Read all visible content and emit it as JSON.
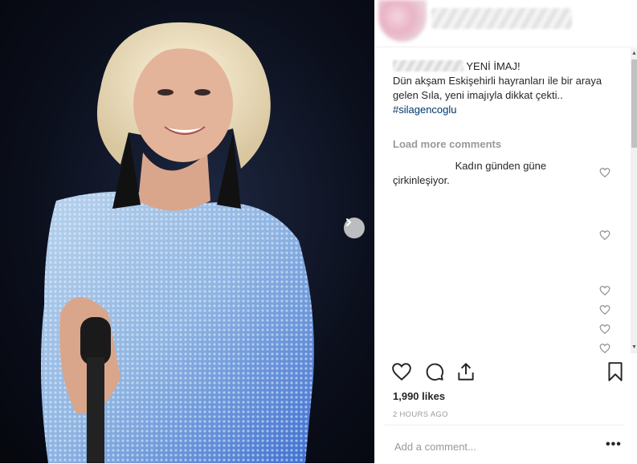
{
  "post": {
    "caption_title": "YENİ İMAJ!",
    "caption_body": "Dün akşam Eskişehirli hayranları ile bir araya gelen Sıla, yeni imajıyla dikkat çekti..",
    "hashtag": "#silagencoglu"
  },
  "comments": {
    "load_more_label": "Load more comments",
    "first_comment_text": "Kadın günden güne çirkinleşiyor.",
    "like_icon": "heart-outline-icon"
  },
  "actions": {
    "like_icon": "heart-icon",
    "comment_icon": "comment-icon",
    "share_icon": "share-icon",
    "save_icon": "bookmark-icon"
  },
  "stats": {
    "likes_label": "1,990 likes",
    "timestamp": "2 HOURS AGO"
  },
  "add_comment": {
    "placeholder": "Add a comment...",
    "more_label": "•••"
  },
  "carousel": {
    "next_icon": "chevron-right-icon"
  }
}
